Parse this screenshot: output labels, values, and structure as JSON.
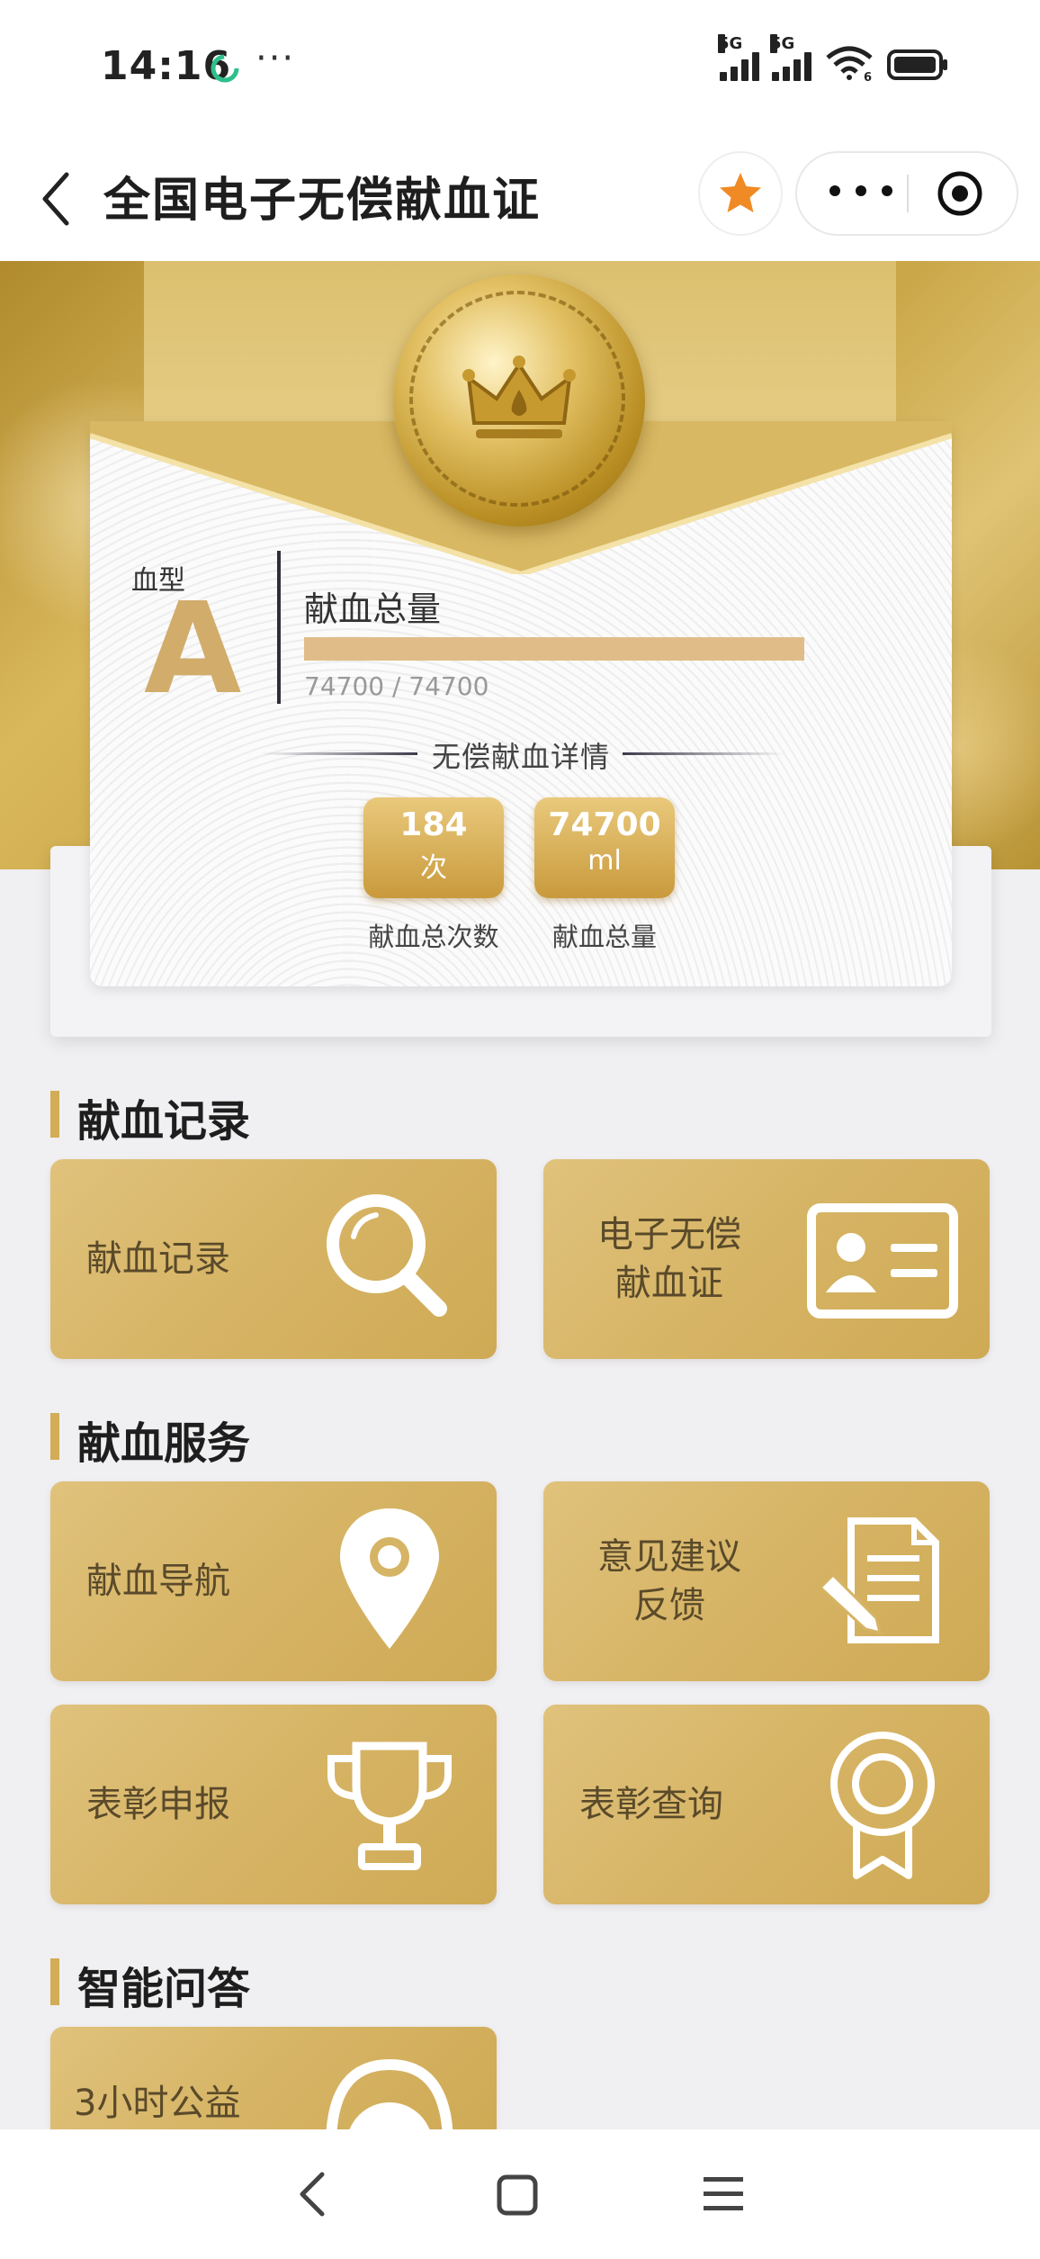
{
  "status_bar": {
    "time": "14:16",
    "more": "···",
    "signal1": "5G",
    "signal2": "5G",
    "wifi_badge": "6"
  },
  "nav": {
    "title": "全国电子无偿献血证"
  },
  "colors": {
    "gold": "#d2ac56",
    "tile_gold": "#d6b465",
    "letter_gold": "#d2ac6b",
    "star": "#f08a24"
  },
  "card": {
    "blood_type_label": "血型",
    "blood_type": "A",
    "total_title": "献血总量",
    "total_value": "74700 / 74700",
    "progress_fraction": 1.0,
    "detail_title": "无偿献血详情",
    "stats": [
      {
        "value": "184",
        "unit": "次",
        "label": "献血总次数"
      },
      {
        "value": "74700",
        "unit": "ml",
        "label": "献血总量"
      }
    ]
  },
  "sections": {
    "records": {
      "title": "献血记录",
      "tiles": [
        {
          "label": "献血记录",
          "icon": "magnifier-icon"
        },
        {
          "label_line1": "电子无偿",
          "label_line2": "献血证",
          "icon": "id-card-icon"
        }
      ]
    },
    "services": {
      "title": "献血服务",
      "tiles": [
        {
          "label": "献血导航",
          "icon": "location-pin-icon"
        },
        {
          "label_line1": "意见建议",
          "label_line2": "反馈",
          "icon": "document-edit-icon"
        },
        {
          "label": "表彰申报",
          "icon": "trophy-icon"
        },
        {
          "label": "表彰查询",
          "icon": "award-ribbon-icon"
        }
      ]
    },
    "qa": {
      "title": "智能问答",
      "tiles": [
        {
          "label": "3小时公益",
          "icon": "robot-icon"
        }
      ]
    }
  }
}
